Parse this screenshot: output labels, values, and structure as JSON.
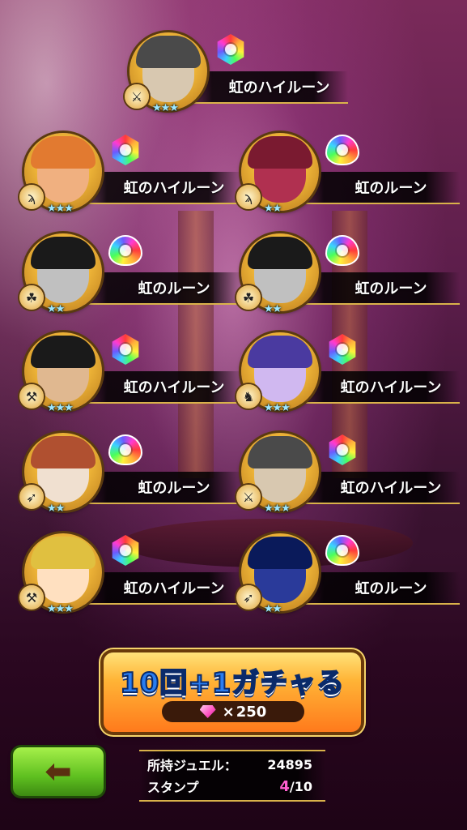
{
  "cards": [
    {
      "label": "虹のハイルーン",
      "stars": "★★★",
      "rune": "hex",
      "class_icon": "sword-icon",
      "portrait_colors": [
        "#d8c8b0",
        "#4a4a4a"
      ]
    },
    {
      "label": "虹のハイルーン",
      "stars": "★★★",
      "rune": "hex",
      "class_icon": "staff-icon",
      "portrait_colors": [
        "#f0b080",
        "#e27a30"
      ]
    },
    {
      "label": "虹のルーン",
      "stars": "★★",
      "rune": "drop",
      "class_icon": "staff-icon",
      "portrait_colors": [
        "#b03050",
        "#7a1a30"
      ]
    },
    {
      "label": "虹のルーン",
      "stars": "★★",
      "rune": "drop",
      "class_icon": "paw-icon",
      "portrait_colors": [
        "#c0c0c0",
        "#1a1a1a"
      ]
    },
    {
      "label": "虹のルーン",
      "stars": "★★",
      "rune": "drop",
      "class_icon": "paw-icon",
      "portrait_colors": [
        "#c0c0c0",
        "#1a1a1a"
      ]
    },
    {
      "label": "虹のハイルーン",
      "stars": "★★★",
      "rune": "hex",
      "class_icon": "axe-icon",
      "portrait_colors": [
        "#e0b890",
        "#1a1a1a"
      ]
    },
    {
      "label": "虹のハイルーン",
      "stars": "★★★",
      "rune": "hex",
      "class_icon": "dragon-icon",
      "portrait_colors": [
        "#d0b8f0",
        "#4a3aa0"
      ]
    },
    {
      "label": "虹のルーン",
      "stars": "★★",
      "rune": "drop",
      "class_icon": "bow-icon",
      "portrait_colors": [
        "#f0e0d0",
        "#b05030"
      ]
    },
    {
      "label": "虹のハイルーン",
      "stars": "★★★",
      "rune": "hex",
      "class_icon": "sword-icon",
      "portrait_colors": [
        "#d8c8b0",
        "#4a4a4a"
      ]
    },
    {
      "label": "虹のハイルーン",
      "stars": "★★★",
      "rune": "hex",
      "class_icon": "axe-icon",
      "portrait_colors": [
        "#ffe0c0",
        "#e0c040"
      ]
    },
    {
      "label": "虹のルーン",
      "stars": "★★",
      "rune": "drop",
      "class_icon": "bow-icon",
      "portrait_colors": [
        "#2a3a9a",
        "#0a1a5a"
      ]
    }
  ],
  "gacha": {
    "title": "10回+1ガチャる",
    "cost_prefix": "× ",
    "cost": "250"
  },
  "info": {
    "jewel_label": "所持ジュエル：",
    "jewel_value": "24895",
    "stamp_label": "スタンプ",
    "stamp_current": "4",
    "stamp_total": "/10"
  },
  "back_icon": "left-arrow-icon"
}
